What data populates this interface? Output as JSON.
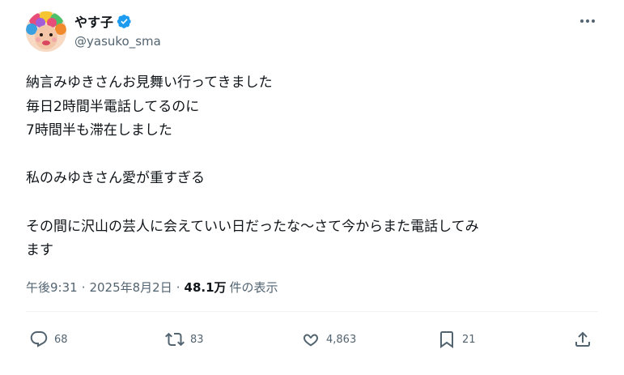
{
  "author": {
    "name": "やす子",
    "handle": "@yasuko_sma"
  },
  "tweet": {
    "lines": [
      "納言みゆきさんお見舞い行ってきました",
      "毎日2時間半電話してるのに",
      "7時間半も滞在しました",
      "",
      "私のみゆきさん愛が重すぎる",
      "",
      "その間に沢山の芸人に会えていい日だったな〜さて今からまた電話してみ",
      "ます"
    ]
  },
  "meta": {
    "time": "午後9:31",
    "date": "2025年8月2日",
    "views_count": "48.1万",
    "views_label": "件の表示"
  },
  "actions": {
    "replies": "68",
    "reposts": "83",
    "likes": "4,863",
    "bookmarks": "21"
  },
  "colors": {
    "text": "#0f1419",
    "secondary": "#536471",
    "verified": "#1d9bf0",
    "divider": "#eff3f4"
  }
}
